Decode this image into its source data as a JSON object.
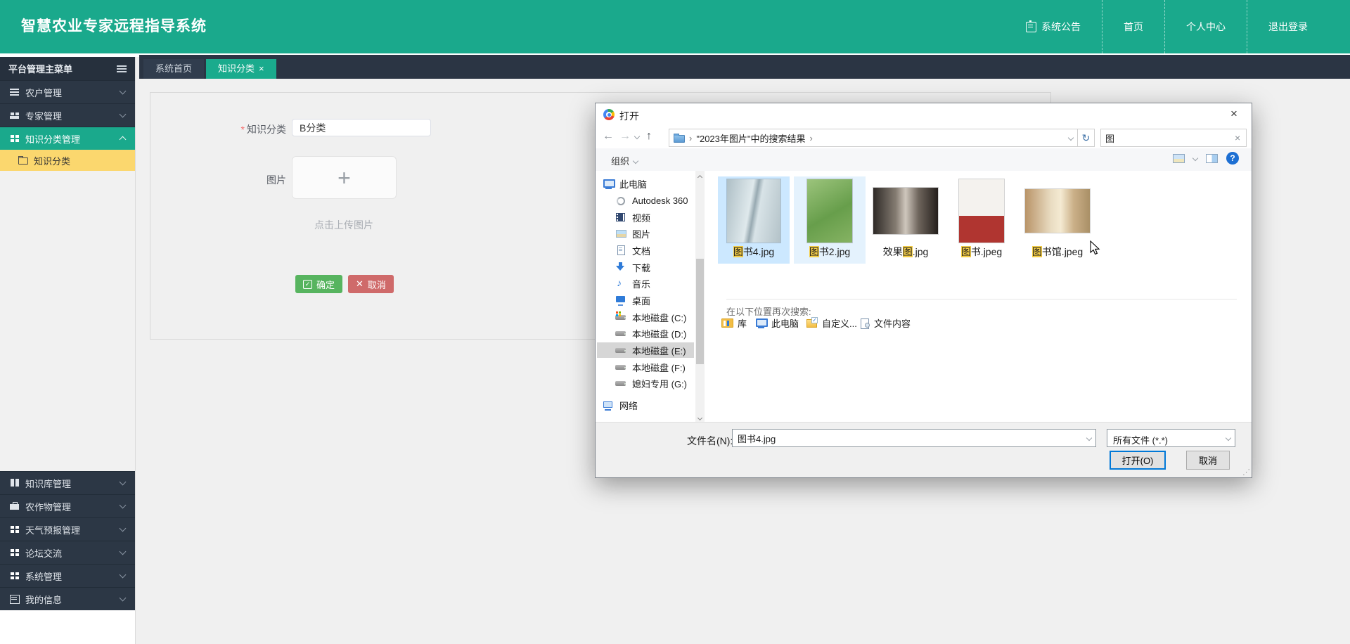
{
  "colors": {
    "header_teal": "#1aa98c",
    "sidebar_dark": "#2c3745",
    "active_tab_teal": "#1aab8d",
    "submenu_yellow": "#fbd76e",
    "confirm_green": "#57b45f",
    "cancel_red": "#cf6a6a",
    "file_selection_blue": "#cce8ff",
    "file_hover_blue": "#e4f2fd",
    "search_highlight_yellow": "#f6cf47",
    "focus_border_blue": "#0078d7"
  },
  "header": {
    "title": "智慧农业专家远程指导系统",
    "nav": [
      {
        "label": "系统公告"
      },
      {
        "label": "首页"
      },
      {
        "label": "个人中心"
      },
      {
        "label": "退出登录"
      }
    ]
  },
  "sidebar": {
    "title": "平台管理主菜单",
    "items_top": [
      {
        "label": "农户管理"
      },
      {
        "label": "专家管理"
      },
      {
        "label": "知识分类管理"
      }
    ],
    "submenu": {
      "label": "知识分类"
    },
    "items_bottom": [
      {
        "label": "知识库管理"
      },
      {
        "label": "农作物管理"
      },
      {
        "label": "天气预报管理"
      },
      {
        "label": "论坛交流"
      },
      {
        "label": "系统管理"
      },
      {
        "label": "我的信息"
      }
    ]
  },
  "tabs": {
    "items": [
      {
        "label": "系统首页"
      },
      {
        "label": "知识分类"
      }
    ],
    "close_glyph": "×"
  },
  "form": {
    "required_mark": "*",
    "category_label": "知识分类",
    "category_value": "B分类",
    "image_label": "图片",
    "upload_plus": "+",
    "upload_hint": "点击上传图片",
    "confirm_label": "确定",
    "confirm_icon_glyph": "✓",
    "cancel_icon_glyph": "✕",
    "cancel_label": "取消"
  },
  "dialog": {
    "title": "打开",
    "close_glyph": "×",
    "nav": {
      "back": "←",
      "forward": "→",
      "up": "↑",
      "refresh": "↻",
      "crumb_sep": "›",
      "search_clear": "×"
    },
    "breadcrumb": "\"2023年图片\"中的搜索结果",
    "search_value": "图",
    "organize_label": "组织",
    "help_glyph": "?",
    "tree": [
      {
        "label": "此电脑"
      },
      {
        "label": "Autodesk 360"
      },
      {
        "label": "视频"
      },
      {
        "label": "图片"
      },
      {
        "label": "文档"
      },
      {
        "label": "下载"
      },
      {
        "label": "音乐"
      },
      {
        "label": "桌面"
      },
      {
        "label": "本地磁盘 (C:)"
      },
      {
        "label": "本地磁盘 (D:)"
      },
      {
        "label": "本地磁盘 (E:)"
      },
      {
        "label": "本地磁盘 (F:)"
      },
      {
        "label": "媳妇专用 (G:)"
      },
      {
        "label": "网络"
      }
    ],
    "files": [
      {
        "name": "图书4.jpg",
        "pre": "",
        "hl": "图",
        "post": "书4.jpg"
      },
      {
        "name": "图书2.jpg",
        "pre": "",
        "hl": "图",
        "post": "书2.jpg"
      },
      {
        "name": "效果图.jpg",
        "pre": "效果",
        "hl": "图",
        "post": ".jpg"
      },
      {
        "name": "图书.jpeg",
        "pre": "",
        "hl": "图",
        "post": "书.jpeg"
      },
      {
        "name": "图书馆.jpeg",
        "pre": "",
        "hl": "图",
        "post": "书馆.jpeg"
      }
    ],
    "search_again": {
      "label": "在以下位置再次搜索:",
      "options": [
        {
          "label": "库"
        },
        {
          "label": "此电脑"
        },
        {
          "label": "自定义..."
        },
        {
          "label": "文件内容"
        }
      ]
    },
    "footer": {
      "filename_label": "文件名(N):",
      "filename_value": "图书4.jpg",
      "filetype_value": "所有文件 (*.*)",
      "open_label": "打开(O)",
      "cancel_label": "取消"
    }
  }
}
